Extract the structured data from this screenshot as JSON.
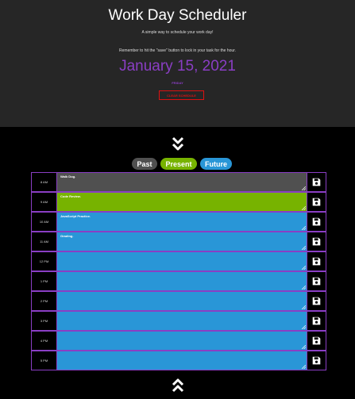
{
  "header": {
    "title": "Work Day Scheduler",
    "subtitle": "A simple way to schedule your work day!",
    "instructions": "Remember to hit the \"save\" button to lock in your task for the hour.",
    "date": "January 15, 2021",
    "day": "FRIDAY",
    "clear_label": "CLEAR SCHEDULE"
  },
  "legend": {
    "past": "Past",
    "present": "Present",
    "future": "Future"
  },
  "colors": {
    "accent": "#8a3ec4",
    "past": "#505050",
    "present": "#77b300",
    "future": "#2996d7",
    "clear": "#dd1111"
  },
  "icons": {
    "scroll_down": "double-chevron-down-icon",
    "scroll_up": "double-chevron-up-icon",
    "save": "floppy-disk-icon"
  },
  "hours": [
    {
      "label": "8 AM",
      "task": "Walk Dog.",
      "state": "past"
    },
    {
      "label": "9 AM",
      "task": "Code Review.",
      "state": "present"
    },
    {
      "label": "10 AM",
      "task": "JavaScript Practice.",
      "state": "future"
    },
    {
      "label": "11 AM",
      "task": "Grading.",
      "state": "future"
    },
    {
      "label": "12 PM",
      "task": "",
      "state": "future"
    },
    {
      "label": "1 PM",
      "task": "",
      "state": "future"
    },
    {
      "label": "2 PM",
      "task": "",
      "state": "future"
    },
    {
      "label": "3 PM",
      "task": "",
      "state": "future"
    },
    {
      "label": "4 PM",
      "task": "",
      "state": "future"
    },
    {
      "label": "5 PM",
      "task": "",
      "state": "future"
    }
  ]
}
